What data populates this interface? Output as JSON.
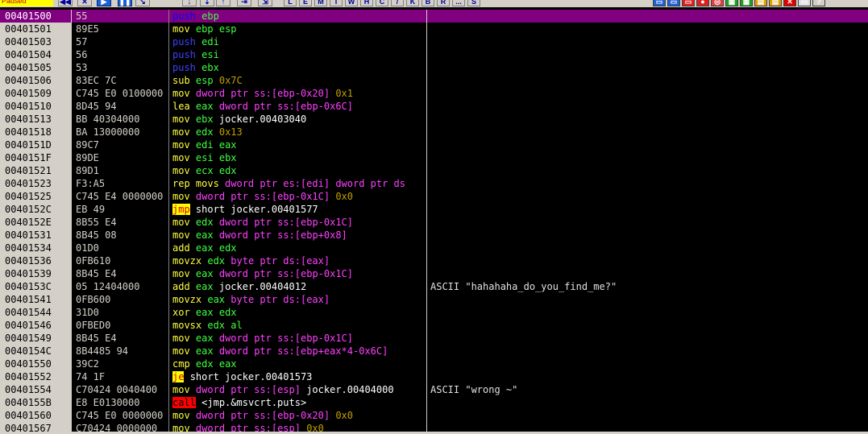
{
  "toolbar": {
    "status": "Paused",
    "buttons": [
      "◀◀",
      "✕",
      "▶",
      "❚❚",
      "↘",
      "↓",
      "⇣",
      "↑",
      "⇥",
      "⇲"
    ],
    "letters": [
      "L",
      "E",
      "M",
      "T",
      "W",
      "H",
      "C",
      "/",
      "K",
      "B",
      "R",
      "...",
      "S"
    ],
    "right_icons": [
      "▭",
      "▭",
      "▭",
      "●",
      "◎",
      "▦",
      "▦",
      "▤",
      "▤",
      "✕",
      "▭",
      "?"
    ]
  },
  "rows": [
    {
      "addr": "00401500",
      "hex": "55",
      "tokens": [
        [
          "push",
          "mn push"
        ],
        [
          " ",
          ""
        ],
        [
          "ebp",
          "reg"
        ]
      ],
      "comment": ""
    },
    {
      "addr": "00401501",
      "hex": "89E5",
      "tokens": [
        [
          "mov",
          "mn"
        ],
        [
          " ",
          ""
        ],
        [
          "ebp",
          "reg"
        ],
        [
          ",",
          ""
        ],
        [
          "esp",
          "reg"
        ]
      ],
      "comment": ""
    },
    {
      "addr": "00401503",
      "hex": "57",
      "tokens": [
        [
          "push",
          "mn push"
        ],
        [
          " ",
          ""
        ],
        [
          "edi",
          "reg"
        ]
      ],
      "comment": ""
    },
    {
      "addr": "00401504",
      "hex": "56",
      "tokens": [
        [
          "push",
          "mn push"
        ],
        [
          " ",
          ""
        ],
        [
          "esi",
          "reg"
        ]
      ],
      "comment": ""
    },
    {
      "addr": "00401505",
      "hex": "53",
      "tokens": [
        [
          "push",
          "mn push"
        ],
        [
          " ",
          ""
        ],
        [
          "ebx",
          "reg"
        ]
      ],
      "comment": ""
    },
    {
      "addr": "00401506",
      "hex": "83EC 7C",
      "tokens": [
        [
          "sub",
          "mn"
        ],
        [
          " ",
          ""
        ],
        [
          "esp",
          "reg"
        ],
        [
          ",",
          ""
        ],
        [
          "0x7C",
          "imm"
        ]
      ],
      "comment": ""
    },
    {
      "addr": "00401509",
      "hex": "C745 E0 0100000",
      "tokens": [
        [
          "mov",
          "mn"
        ],
        [
          " ",
          ""
        ],
        [
          "dword ptr ss:[ebp-0x20]",
          "mem"
        ],
        [
          ",",
          ""
        ],
        [
          "0x1",
          "imm"
        ]
      ],
      "comment": ""
    },
    {
      "addr": "00401510",
      "hex": "8D45 94",
      "tokens": [
        [
          "lea",
          "mn"
        ],
        [
          " ",
          ""
        ],
        [
          "eax",
          "reg"
        ],
        [
          ",",
          ""
        ],
        [
          "dword ptr ss:[ebp-0x6C]",
          "mem"
        ]
      ],
      "comment": ""
    },
    {
      "addr": "00401513",
      "hex": "BB 40304000",
      "tokens": [
        [
          "mov",
          "mn"
        ],
        [
          " ",
          ""
        ],
        [
          "ebx",
          "reg"
        ],
        [
          ",",
          ""
        ],
        [
          "jocker.00403040",
          "txt"
        ]
      ],
      "comment": ""
    },
    {
      "addr": "00401518",
      "hex": "BA 13000000",
      "tokens": [
        [
          "mov",
          "mn"
        ],
        [
          " ",
          ""
        ],
        [
          "edx",
          "reg"
        ],
        [
          ",",
          ""
        ],
        [
          "0x13",
          "imm"
        ]
      ],
      "comment": ""
    },
    {
      "addr": "0040151D",
      "hex": "89C7",
      "tokens": [
        [
          "mov",
          "mn"
        ],
        [
          " ",
          ""
        ],
        [
          "edi",
          "reg"
        ],
        [
          ",",
          ""
        ],
        [
          "eax",
          "reg"
        ]
      ],
      "comment": ""
    },
    {
      "addr": "0040151F",
      "hex": "89DE",
      "tokens": [
        [
          "mov",
          "mn"
        ],
        [
          " ",
          ""
        ],
        [
          "esi",
          "reg"
        ],
        [
          ",",
          ""
        ],
        [
          "ebx",
          "reg"
        ]
      ],
      "comment": ""
    },
    {
      "addr": "00401521",
      "hex": "89D1",
      "tokens": [
        [
          "mov",
          "mn"
        ],
        [
          " ",
          ""
        ],
        [
          "ecx",
          "reg"
        ],
        [
          ",",
          ""
        ],
        [
          "edx",
          "reg"
        ]
      ],
      "comment": ""
    },
    {
      "addr": "00401523",
      "hex": "F3:A5",
      "tokens": [
        [
          "rep movs",
          "mn"
        ],
        [
          " ",
          ""
        ],
        [
          "dword ptr es:[edi]",
          "mem"
        ],
        [
          ",",
          ""
        ],
        [
          "dword ptr ds",
          "mem"
        ]
      ],
      "comment": ""
    },
    {
      "addr": "00401525",
      "hex": "C745 E4 0000000",
      "tokens": [
        [
          "mov",
          "mn"
        ],
        [
          " ",
          ""
        ],
        [
          "dword ptr ss:[ebp-0x1C]",
          "mem"
        ],
        [
          ",",
          ""
        ],
        [
          "0x0",
          "imm"
        ]
      ],
      "comment": ""
    },
    {
      "addr": "0040152C",
      "hex": "EB 49",
      "tokens": [
        [
          "jmp",
          "mn jmp"
        ],
        [
          " ",
          ""
        ],
        [
          "short jocker.00401577",
          "txt"
        ]
      ],
      "comment": ""
    },
    {
      "addr": "0040152E",
      "hex": "8B55 E4",
      "tokens": [
        [
          "mov",
          "mn"
        ],
        [
          " ",
          ""
        ],
        [
          "edx",
          "reg"
        ],
        [
          ",",
          ""
        ],
        [
          "dword ptr ss:[ebp-0x1C]",
          "mem"
        ]
      ],
      "comment": ""
    },
    {
      "addr": "00401531",
      "hex": "8B45 08",
      "tokens": [
        [
          "mov",
          "mn"
        ],
        [
          " ",
          ""
        ],
        [
          "eax",
          "reg"
        ],
        [
          ",",
          ""
        ],
        [
          "dword ptr ss:[ebp+0x8]",
          "mem"
        ]
      ],
      "comment": ""
    },
    {
      "addr": "00401534",
      "hex": "01D0",
      "tokens": [
        [
          "add",
          "mn"
        ],
        [
          " ",
          ""
        ],
        [
          "eax",
          "reg"
        ],
        [
          ",",
          ""
        ],
        [
          "edx",
          "reg"
        ]
      ],
      "comment": ""
    },
    {
      "addr": "00401536",
      "hex": "0FB610",
      "tokens": [
        [
          "movzx",
          "mn"
        ],
        [
          " ",
          ""
        ],
        [
          "edx",
          "reg"
        ],
        [
          ",",
          ""
        ],
        [
          "byte ptr ds:[eax]",
          "mem"
        ]
      ],
      "comment": ""
    },
    {
      "addr": "00401539",
      "hex": "8B45 E4",
      "tokens": [
        [
          "mov",
          "mn"
        ],
        [
          " ",
          ""
        ],
        [
          "eax",
          "reg"
        ],
        [
          ",",
          ""
        ],
        [
          "dword ptr ss:[ebp-0x1C]",
          "mem"
        ]
      ],
      "comment": ""
    },
    {
      "addr": "0040153C",
      "hex": "05 12404000",
      "tokens": [
        [
          "add",
          "mn"
        ],
        [
          " ",
          ""
        ],
        [
          "eax",
          "reg"
        ],
        [
          ",",
          ""
        ],
        [
          "jocker.00404012",
          "txt"
        ]
      ],
      "comment": "ASCII \"hahahaha_do_you_find_me?\""
    },
    {
      "addr": "00401541",
      "hex": "0FB600",
      "tokens": [
        [
          "movzx",
          "mn"
        ],
        [
          " ",
          ""
        ],
        [
          "eax",
          "reg"
        ],
        [
          ",",
          ""
        ],
        [
          "byte ptr ds:[eax]",
          "mem"
        ]
      ],
      "comment": ""
    },
    {
      "addr": "00401544",
      "hex": "31D0",
      "tokens": [
        [
          "xor",
          "mn"
        ],
        [
          " ",
          ""
        ],
        [
          "eax",
          "reg"
        ],
        [
          ",",
          ""
        ],
        [
          "edx",
          "reg"
        ]
      ],
      "comment": ""
    },
    {
      "addr": "00401546",
      "hex": "0FBED0",
      "tokens": [
        [
          "movsx",
          "mn"
        ],
        [
          " ",
          ""
        ],
        [
          "edx",
          "reg"
        ],
        [
          ",",
          ""
        ],
        [
          "al",
          "reg"
        ]
      ],
      "comment": ""
    },
    {
      "addr": "00401549",
      "hex": "8B45 E4",
      "tokens": [
        [
          "mov",
          "mn"
        ],
        [
          " ",
          ""
        ],
        [
          "eax",
          "reg"
        ],
        [
          ",",
          ""
        ],
        [
          "dword ptr ss:[ebp-0x1C]",
          "mem"
        ]
      ],
      "comment": ""
    },
    {
      "addr": "0040154C",
      "hex": "8B4485 94",
      "tokens": [
        [
          "mov",
          "mn"
        ],
        [
          " ",
          ""
        ],
        [
          "eax",
          "reg"
        ],
        [
          ",",
          ""
        ],
        [
          "dword ptr ss:[ebp+eax*4-0x6C]",
          "mem"
        ]
      ],
      "comment": ""
    },
    {
      "addr": "00401550",
      "hex": "39C2",
      "tokens": [
        [
          "cmp",
          "mn"
        ],
        [
          " ",
          ""
        ],
        [
          "edx",
          "reg"
        ],
        [
          ",",
          ""
        ],
        [
          "eax",
          "reg"
        ]
      ],
      "comment": ""
    },
    {
      "addr": "00401552",
      "hex": "74 1F",
      "tokens": [
        [
          "je",
          "mn jmp"
        ],
        [
          " ",
          ""
        ],
        [
          "short jocker.00401573",
          "txt"
        ]
      ],
      "comment": ""
    },
    {
      "addr": "00401554",
      "hex": "C70424 0040400",
      "tokens": [
        [
          "mov",
          "mn"
        ],
        [
          " ",
          ""
        ],
        [
          "dword ptr ss:[esp]",
          "mem"
        ],
        [
          ",",
          ""
        ],
        [
          "jocker.00404000",
          "txt"
        ]
      ],
      "comment": "ASCII \"wrong ~\""
    },
    {
      "addr": "0040155B",
      "hex": "E8 E0130000",
      "tokens": [
        [
          "call",
          "mn call"
        ],
        [
          " ",
          ""
        ],
        [
          "<jmp.&msvcrt.puts>",
          "txt"
        ]
      ],
      "comment": ""
    },
    {
      "addr": "00401560",
      "hex": "C745 E0 0000000",
      "tokens": [
        [
          "mov",
          "mn"
        ],
        [
          " ",
          ""
        ],
        [
          "dword ptr ss:[ebp-0x20]",
          "mem"
        ],
        [
          ",",
          ""
        ],
        [
          "0x0",
          "imm"
        ]
      ],
      "comment": ""
    },
    {
      "addr": "00401567",
      "hex": "C70424 0000000",
      "tokens": [
        [
          "mov",
          "mn"
        ],
        [
          " ",
          ""
        ],
        [
          "dword ptr ss:[esp]",
          "mem"
        ],
        [
          ",",
          ""
        ],
        [
          "0x0",
          "imm"
        ]
      ],
      "comment": ""
    }
  ]
}
